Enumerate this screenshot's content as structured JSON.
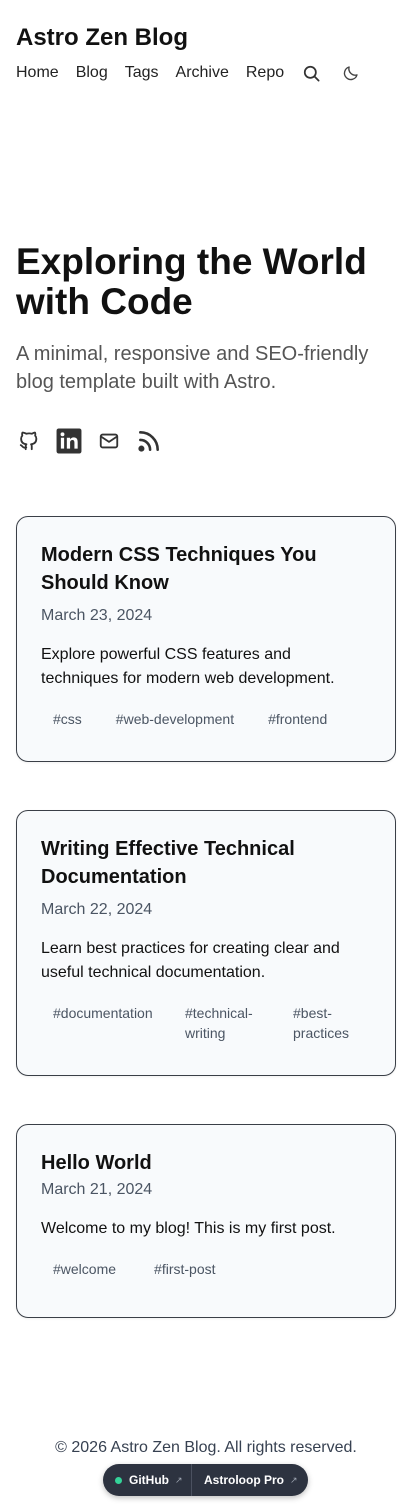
{
  "site": {
    "title": "Astro Zen Blog"
  },
  "nav": {
    "items": [
      "Home",
      "Blog",
      "Tags",
      "Archive",
      "Repo"
    ],
    "icons": [
      "search-icon",
      "moon-icon"
    ]
  },
  "hero": {
    "title": "Exploring the World with Code",
    "subtitle": "A minimal, responsive and SEO-friendly blog template built with Astro.",
    "socials": [
      "github-icon",
      "linkedin-icon",
      "mail-icon",
      "rss-icon"
    ]
  },
  "posts": [
    {
      "title": "Modern CSS Techniques You Should Know",
      "date": "March 23, 2024",
      "description": "Explore powerful CSS features and techniques for modern web development.",
      "tags": [
        "#css",
        "#web-development",
        "#frontend"
      ]
    },
    {
      "title": "Writing Effective Technical Documentation",
      "date": "March 22, 2024",
      "description": "Learn best practices for creating clear and useful technical documentation.",
      "tags": [
        "#documentation",
        "#technical-writing",
        "#best-practices"
      ]
    },
    {
      "title": "Hello World",
      "date": "March 21, 2024",
      "description": "Welcome to my blog! This is my first post.",
      "tags": [
        "#welcome",
        "#first-post"
      ]
    }
  ],
  "footer": {
    "copyright": "© 2026 Astro Zen Blog. All rights reserved."
  },
  "promo": {
    "github_label": "GitHub",
    "pro_label": "Astroloop Pro",
    "arrow": "↗",
    "status_color": "#34d399"
  }
}
